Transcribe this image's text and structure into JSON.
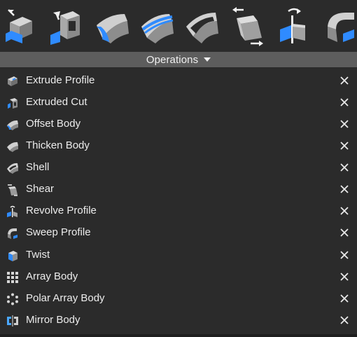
{
  "toolbar": {
    "tools": [
      {
        "name": "extrude-profile-tool-icon"
      },
      {
        "name": "extruded-cut-tool-icon"
      },
      {
        "name": "offset-body-tool-icon"
      },
      {
        "name": "thicken-body-tool-icon"
      },
      {
        "name": "shell-tool-icon"
      },
      {
        "name": "shear-tool-icon"
      },
      {
        "name": "revolve-profile-tool-icon"
      },
      {
        "name": "sweep-profile-tool-icon"
      }
    ]
  },
  "header": {
    "title": "Operations"
  },
  "operations": [
    {
      "label": "Extrude Profile",
      "icon": "extrude-icon"
    },
    {
      "label": "Extruded Cut",
      "icon": "extruded-cut-icon"
    },
    {
      "label": "Offset Body",
      "icon": "offset-body-icon"
    },
    {
      "label": "Thicken Body",
      "icon": "thicken-body-icon"
    },
    {
      "label": "Shell",
      "icon": "shell-icon"
    },
    {
      "label": "Shear",
      "icon": "shear-icon"
    },
    {
      "label": "Revolve Profile",
      "icon": "revolve-icon"
    },
    {
      "label": "Sweep Profile",
      "icon": "sweep-icon"
    },
    {
      "label": "Twist",
      "icon": "twist-icon"
    },
    {
      "label": "Array Body",
      "icon": "array-icon"
    },
    {
      "label": "Polar Array Body",
      "icon": "polar-array-icon"
    },
    {
      "label": "Mirror Body",
      "icon": "mirror-icon"
    }
  ],
  "colors": {
    "accent": "#2f8bff",
    "header_bg": "#5d5d5d",
    "panel_bg": "#2b2b2b"
  }
}
